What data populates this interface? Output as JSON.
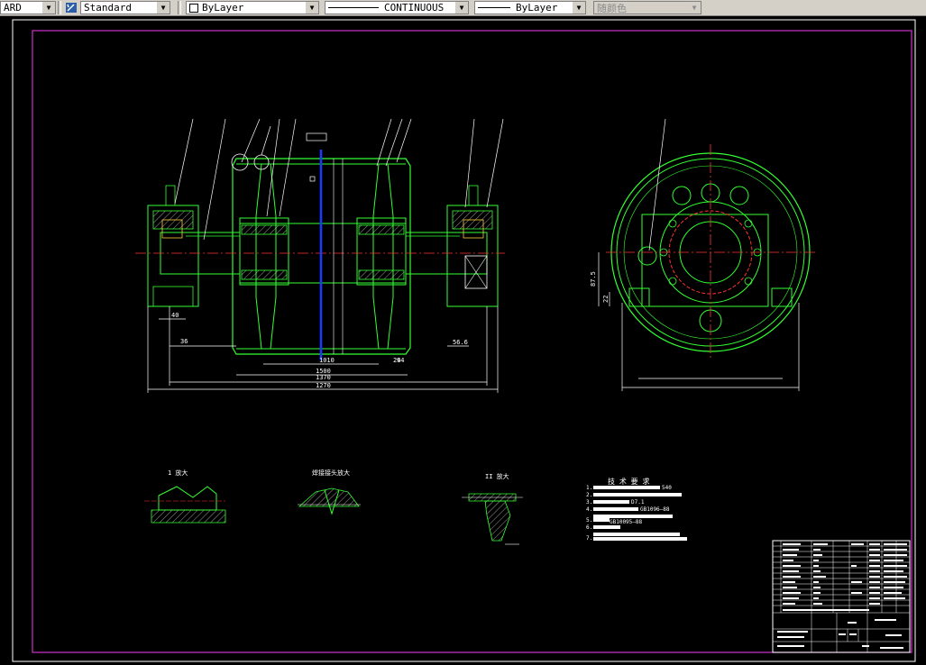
{
  "toolbar": {
    "text_style_partial": "ARD",
    "dim_style": "Standard",
    "layer": "ByLayer",
    "linetype_name": "CONTINUOUS",
    "lineweight": "ByLayer",
    "plot_color": "随颜色"
  },
  "drawing": {
    "dims_main": [
      "36",
      "40",
      "1010",
      "1500",
      "1370",
      "94",
      "1270",
      "24",
      "56.6"
    ],
    "dims_side": [
      "87.5",
      "22"
    ],
    "detail_labels": [
      "1 放大",
      "焊接接头放大",
      "II 放大"
    ],
    "tech_title": "技 术 要 求",
    "tech_notes": [
      "1.",
      "2.",
      "3.",
      "4.",
      "5.",
      "6.",
      "7."
    ],
    "tech_fragments": [
      "540",
      "D7.1",
      "GB1096—88",
      "GB10095—88"
    ]
  },
  "colors": {
    "border": "#cc33cc",
    "frame": "#ffffff",
    "part_green": "#33ff33",
    "center_red": "#ff3333",
    "axis_blue": "#1a3cff",
    "text_white": "#ffffff"
  }
}
